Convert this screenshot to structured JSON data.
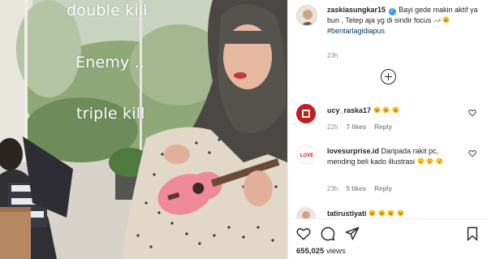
{
  "media": {
    "overlay_lines": [
      "double kill",
      "Enemy ..",
      "triple kill"
    ]
  },
  "post": {
    "username": "zaskiasungkar15",
    "caption_before": "Bayi gede makin aktif ya bun , Tetep aja yg di sindir focus",
    "hashtag": "#bentarlagidiapus",
    "time": "23h"
  },
  "comments": [
    {
      "username": "ucy_raska17",
      "text": "",
      "emojis": [
        "grin-emoji",
        "grin-emoji",
        "grin-emoji"
      ],
      "time": "22h",
      "likes": "7 likes",
      "reply": "Reply"
    },
    {
      "username": "lovesurprise.id",
      "text": "Daripada rakit pc, mending beli kado illustrasi",
      "emojis": [
        "heart-eyes-emoji",
        "heart-eyes-emoji",
        "heart-eyes-emoji"
      ],
      "time": "23h",
      "likes": "5 likes",
      "reply": "Reply",
      "avatar_label": "LOVE"
    },
    {
      "username": "tatirustiyati",
      "text": "",
      "emojis": [
        "grin-emoji",
        "grin-emoji",
        "grin-emoji",
        "grin-emoji"
      ]
    }
  ],
  "actions": {
    "icons": [
      "heart-icon",
      "comment-icon",
      "share-icon",
      "bookmark-icon"
    ],
    "views_count": "655,025",
    "views_label": "views"
  },
  "colors": {
    "verified": "#3897f0",
    "hashtag": "#00376b",
    "meta": "#8e8e8e",
    "text": "#262626"
  }
}
